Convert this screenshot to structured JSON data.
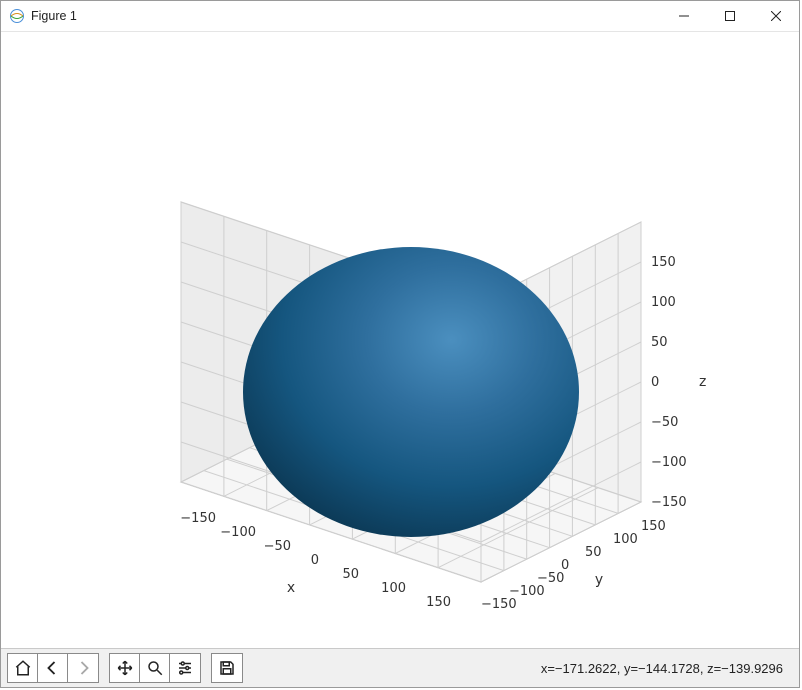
{
  "window": {
    "title": "Figure 1"
  },
  "toolbar": {
    "coord_readout": "x=−171.2622, y=−144.1728, z=−139.9296"
  },
  "chart_data": {
    "type": "surface3d",
    "description": "Shaded solid sphere centered at origin",
    "sphere": {
      "cx": 0,
      "cy": 0,
      "cz": 0,
      "r": 150
    },
    "axes": {
      "x": {
        "label": "x",
        "ticks": [
          -150,
          -100,
          -50,
          0,
          50,
          100,
          150
        ],
        "lim": [
          -175,
          175
        ]
      },
      "y": {
        "label": "y",
        "ticks": [
          -150,
          -100,
          -50,
          0,
          50,
          100,
          150
        ],
        "lim": [
          -175,
          175
        ]
      },
      "z": {
        "label": "z",
        "ticks": [
          -150,
          -100,
          -50,
          0,
          50,
          100,
          150
        ],
        "lim": [
          -175,
          175
        ]
      }
    },
    "xlabel": "x",
    "ylabel": "y",
    "zlabel": "z",
    "colors": {
      "surface_dark": "#0f3b5a",
      "surface_light": "#3a7aa8",
      "grid": "#bfbfbf",
      "pane": "#ececec"
    },
    "view": {
      "elev": 30,
      "azim": -60
    },
    "tick_text": {
      "x": [
        "−150",
        "−100",
        "−50",
        "0",
        "50",
        "100",
        "150"
      ],
      "y": [
        "−150",
        "−100",
        "−50",
        "0",
        "50",
        "100",
        "150"
      ],
      "z": [
        "−150",
        "−100",
        "−50",
        "0",
        "50",
        "100",
        "150"
      ]
    }
  }
}
